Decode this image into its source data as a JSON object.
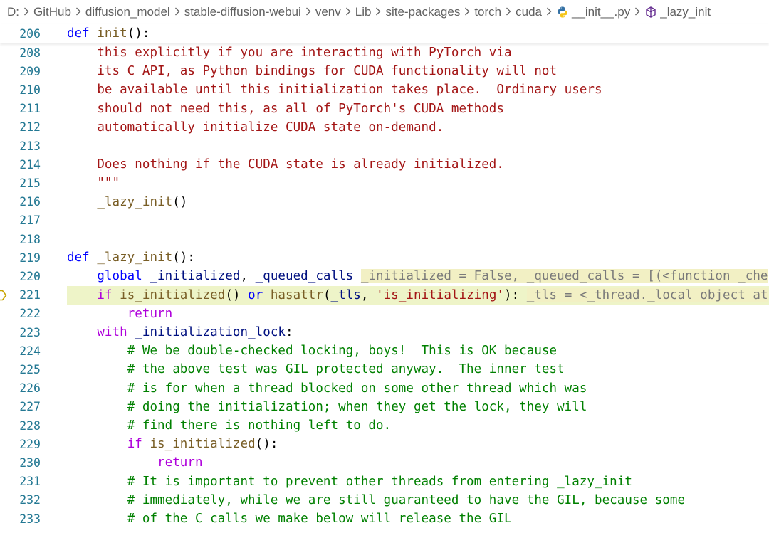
{
  "breadcrumb": {
    "items": [
      {
        "label": "D:",
        "icon": ""
      },
      {
        "label": "GitHub",
        "icon": ""
      },
      {
        "label": "diffusion_model",
        "icon": ""
      },
      {
        "label": "stable-diffusion-webui",
        "icon": ""
      },
      {
        "label": "venv",
        "icon": ""
      },
      {
        "label": "Lib",
        "icon": ""
      },
      {
        "label": "site-packages",
        "icon": ""
      },
      {
        "label": "torch",
        "icon": ""
      },
      {
        "label": "cuda",
        "icon": ""
      },
      {
        "label": "__init__.py",
        "icon": "python-file-icon"
      },
      {
        "label": "_lazy_init",
        "icon": "symbol-method-icon"
      }
    ]
  },
  "sticky": {
    "line_number": "206",
    "code": [
      {
        "text": "def ",
        "cls": "k-blue"
      },
      {
        "text": "init",
        "cls": "k-fn"
      },
      {
        "text": "():",
        "cls": "k-text"
      }
    ]
  },
  "editor": {
    "highlight_color": "#eef4c8",
    "debug_line": "221",
    "lines": [
      {
        "num": "208",
        "indent": 4,
        "tokens": [
          {
            "text": "this explicitly if you are interacting with PyTorch via",
            "cls": "k-doc"
          }
        ]
      },
      {
        "num": "209",
        "indent": 4,
        "tokens": [
          {
            "text": "its C API, as Python bindings for CUDA functionality will not",
            "cls": "k-doc"
          }
        ]
      },
      {
        "num": "210",
        "indent": 4,
        "tokens": [
          {
            "text": "be available until this initialization takes place.  Ordinary users",
            "cls": "k-doc"
          }
        ]
      },
      {
        "num": "211",
        "indent": 4,
        "tokens": [
          {
            "text": "should not need this, as all of PyTorch's CUDA methods",
            "cls": "k-doc"
          }
        ]
      },
      {
        "num": "212",
        "indent": 4,
        "tokens": [
          {
            "text": "automatically initialize CUDA state on-demand.",
            "cls": "k-doc"
          }
        ]
      },
      {
        "num": "213",
        "indent": 0,
        "tokens": []
      },
      {
        "num": "214",
        "indent": 4,
        "tokens": [
          {
            "text": "Does nothing if the CUDA state is already initialized.",
            "cls": "k-doc"
          }
        ]
      },
      {
        "num": "215",
        "indent": 4,
        "tokens": [
          {
            "text": "\"\"\"",
            "cls": "k-doc"
          }
        ]
      },
      {
        "num": "216",
        "indent": 4,
        "tokens": [
          {
            "text": "_lazy_init",
            "cls": "k-fn"
          },
          {
            "text": "()",
            "cls": "k-text"
          }
        ]
      },
      {
        "num": "217",
        "indent": 0,
        "tokens": []
      },
      {
        "num": "218",
        "indent": 0,
        "tokens": []
      },
      {
        "num": "219",
        "indent": 0,
        "tokens": [
          {
            "text": "def ",
            "cls": "k-blue"
          },
          {
            "text": "_lazy_init",
            "cls": "k-fn"
          },
          {
            "text": "():",
            "cls": "k-text"
          }
        ]
      },
      {
        "num": "220",
        "indent": 4,
        "tokens": [
          {
            "text": "global ",
            "cls": "k-blue"
          },
          {
            "text": "_initialized",
            "cls": "k-var"
          },
          {
            "text": ", ",
            "cls": "k-text"
          },
          {
            "text": "_queued_calls",
            "cls": "k-var"
          },
          {
            "text": " ",
            "cls": "k-text"
          },
          {
            "text": "_initialized = False, _queued_calls = [(<function _che",
            "cls": "inline-hint"
          }
        ]
      },
      {
        "num": "221",
        "indent": 4,
        "highlight": true,
        "tokens": [
          {
            "text": "if ",
            "cls": "k-purple"
          },
          {
            "text": "is_initialized",
            "cls": "k-fn"
          },
          {
            "text": "() ",
            "cls": "k-text"
          },
          {
            "text": "or ",
            "cls": "k-blue"
          },
          {
            "text": "hasattr",
            "cls": "k-fn"
          },
          {
            "text": "(",
            "cls": "k-text"
          },
          {
            "text": "_tls",
            "cls": "k-var"
          },
          {
            "text": ", ",
            "cls": "k-text"
          },
          {
            "text": "'is_initializing'",
            "cls": "k-str"
          },
          {
            "text": "): ",
            "cls": "k-text"
          },
          {
            "text": "_tls = <_thread._local object at",
            "cls": "inline-hint"
          }
        ]
      },
      {
        "num": "222",
        "indent": 8,
        "tokens": [
          {
            "text": "return",
            "cls": "k-purple"
          }
        ]
      },
      {
        "num": "223",
        "indent": 4,
        "tokens": [
          {
            "text": "with ",
            "cls": "k-purple"
          },
          {
            "text": "_initialization_lock",
            "cls": "k-var"
          },
          {
            "text": ":",
            "cls": "k-text"
          }
        ]
      },
      {
        "num": "224",
        "indent": 8,
        "tokens": [
          {
            "text": "# We be double-checked locking, boys!  This is OK because",
            "cls": "k-comment"
          }
        ]
      },
      {
        "num": "225",
        "indent": 8,
        "tokens": [
          {
            "text": "# the above test was GIL protected anyway.  The inner test",
            "cls": "k-comment"
          }
        ]
      },
      {
        "num": "226",
        "indent": 8,
        "tokens": [
          {
            "text": "# is for when a thread blocked on some other thread which was",
            "cls": "k-comment"
          }
        ]
      },
      {
        "num": "227",
        "indent": 8,
        "tokens": [
          {
            "text": "# doing the initialization; when they get the lock, they will",
            "cls": "k-comment"
          }
        ]
      },
      {
        "num": "228",
        "indent": 8,
        "tokens": [
          {
            "text": "# find there is nothing left to do.",
            "cls": "k-comment"
          }
        ]
      },
      {
        "num": "229",
        "indent": 8,
        "tokens": [
          {
            "text": "if ",
            "cls": "k-purple"
          },
          {
            "text": "is_initialized",
            "cls": "k-fn"
          },
          {
            "text": "():",
            "cls": "k-text"
          }
        ]
      },
      {
        "num": "230",
        "indent": 12,
        "tokens": [
          {
            "text": "return",
            "cls": "k-purple"
          }
        ]
      },
      {
        "num": "231",
        "indent": 8,
        "tokens": [
          {
            "text": "# It is important to prevent other threads from entering _lazy_init",
            "cls": "k-comment"
          }
        ]
      },
      {
        "num": "232",
        "indent": 8,
        "tokens": [
          {
            "text": "# immediately, while we are still guaranteed to have the GIL, because some",
            "cls": "k-comment"
          }
        ]
      },
      {
        "num": "233",
        "indent": 8,
        "tokens": [
          {
            "text": "# of the C calls we make below will release the GIL",
            "cls": "k-comment"
          }
        ]
      }
    ]
  }
}
